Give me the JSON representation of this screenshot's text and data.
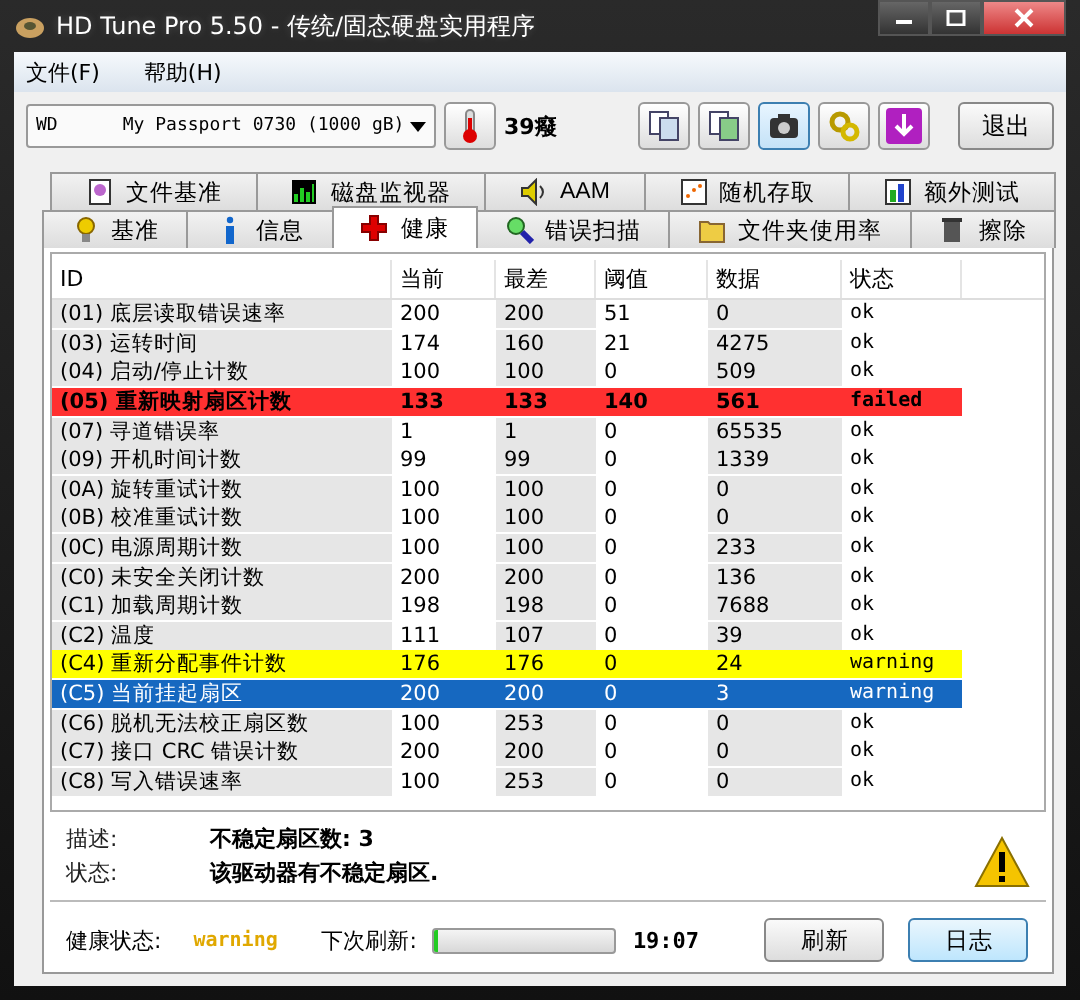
{
  "window": {
    "title": "HD Tune Pro 5.50 - 传统/固态硬盘实用程序"
  },
  "menu": [
    "文件(F)",
    "帮助(H)"
  ],
  "toolbar": {
    "drive": "WD      My Passport 0730 (1000 gB)",
    "temperature": "39癈",
    "exit_button": "退出"
  },
  "tabs_top": [
    {
      "label": "文件基准",
      "selected": false
    },
    {
      "label": "磁盘监视器",
      "selected": false
    },
    {
      "label": "AAM",
      "selected": false
    },
    {
      "label": "随机存取",
      "selected": false
    },
    {
      "label": "额外测试",
      "selected": false
    }
  ],
  "tabs_bottom": [
    {
      "label": "基准",
      "selected": false
    },
    {
      "label": "信息",
      "selected": false
    },
    {
      "label": "健康",
      "selected": true
    },
    {
      "label": "错误扫描",
      "selected": false
    },
    {
      "label": "文件夹使用率",
      "selected": false
    },
    {
      "label": "擦除",
      "selected": false
    }
  ],
  "table": {
    "columns": [
      "ID",
      "当前",
      "最差",
      "阈值",
      "数据",
      "状态"
    ],
    "rows": [
      {
        "id": "(01) 底层读取错误速率",
        "current": "200",
        "worst": "200",
        "threshold": "51",
        "data": "0",
        "status": "ok",
        "kind": "ok",
        "selected": false
      },
      {
        "id": "(03) 运转时间",
        "current": "174",
        "worst": "160",
        "threshold": "21",
        "data": "4275",
        "status": "ok",
        "kind": "ok",
        "selected": false
      },
      {
        "id": "(04) 启动/停止计数",
        "current": "100",
        "worst": "100",
        "threshold": "0",
        "data": "509",
        "status": "ok",
        "kind": "ok",
        "selected": false
      },
      {
        "id": "(05) 重新映射扇区计数",
        "current": "133",
        "worst": "133",
        "threshold": "140",
        "data": "561",
        "status": "failed",
        "kind": "failed",
        "selected": false
      },
      {
        "id": "(07) 寻道错误率",
        "current": "1",
        "worst": "1",
        "threshold": "0",
        "data": "65535",
        "status": "ok",
        "kind": "ok",
        "selected": false
      },
      {
        "id": "(09) 开机时间计数",
        "current": "99",
        "worst": "99",
        "threshold": "0",
        "data": "1339",
        "status": "ok",
        "kind": "ok",
        "selected": false
      },
      {
        "id": "(0A) 旋转重试计数",
        "current": "100",
        "worst": "100",
        "threshold": "0",
        "data": "0",
        "status": "ok",
        "kind": "ok",
        "selected": false
      },
      {
        "id": "(0B) 校准重试计数",
        "current": "100",
        "worst": "100",
        "threshold": "0",
        "data": "0",
        "status": "ok",
        "kind": "ok",
        "selected": false
      },
      {
        "id": "(0C) 电源周期计数",
        "current": "100",
        "worst": "100",
        "threshold": "0",
        "data": "233",
        "status": "ok",
        "kind": "ok",
        "selected": false
      },
      {
        "id": "(C0) 未安全关闭计数",
        "current": "200",
        "worst": "200",
        "threshold": "0",
        "data": "136",
        "status": "ok",
        "kind": "ok",
        "selected": false
      },
      {
        "id": "(C1) 加载周期计数",
        "current": "198",
        "worst": "198",
        "threshold": "0",
        "data": "7688",
        "status": "ok",
        "kind": "ok",
        "selected": false
      },
      {
        "id": "(C2) 温度",
        "current": "111",
        "worst": "107",
        "threshold": "0",
        "data": "39",
        "status": "ok",
        "kind": "ok",
        "selected": false
      },
      {
        "id": "(C4) 重新分配事件计数",
        "current": "176",
        "worst": "176",
        "threshold": "0",
        "data": "24",
        "status": "warning",
        "kind": "warning",
        "selected": false
      },
      {
        "id": "(C5) 当前挂起扇区",
        "current": "200",
        "worst": "200",
        "threshold": "0",
        "data": "3",
        "status": "warning",
        "kind": "warning",
        "selected": true
      },
      {
        "id": "(C6) 脱机无法校正扇区数",
        "current": "100",
        "worst": "253",
        "threshold": "0",
        "data": "0",
        "status": "ok",
        "kind": "ok",
        "selected": false
      },
      {
        "id": "(C7) 接口 CRC 错误计数",
        "current": "200",
        "worst": "200",
        "threshold": "0",
        "data": "0",
        "status": "ok",
        "kind": "ok",
        "selected": false
      },
      {
        "id": "(C8) 写入错误速率",
        "current": "100",
        "worst": "253",
        "threshold": "0",
        "data": "0",
        "status": "ok",
        "kind": "ok",
        "selected": false
      }
    ]
  },
  "details": {
    "description_label": "描述:",
    "description": "不稳定扇区数: 3",
    "status_label": "状态:",
    "status": "该驱动器有不稳定扇区."
  },
  "footer": {
    "health_label": "健康状态:",
    "health": "warning",
    "refresh_label": "下次刷新:",
    "level": 0.02,
    "timer": "19:07",
    "refresh_button": "刷新",
    "log_button": "日志"
  }
}
